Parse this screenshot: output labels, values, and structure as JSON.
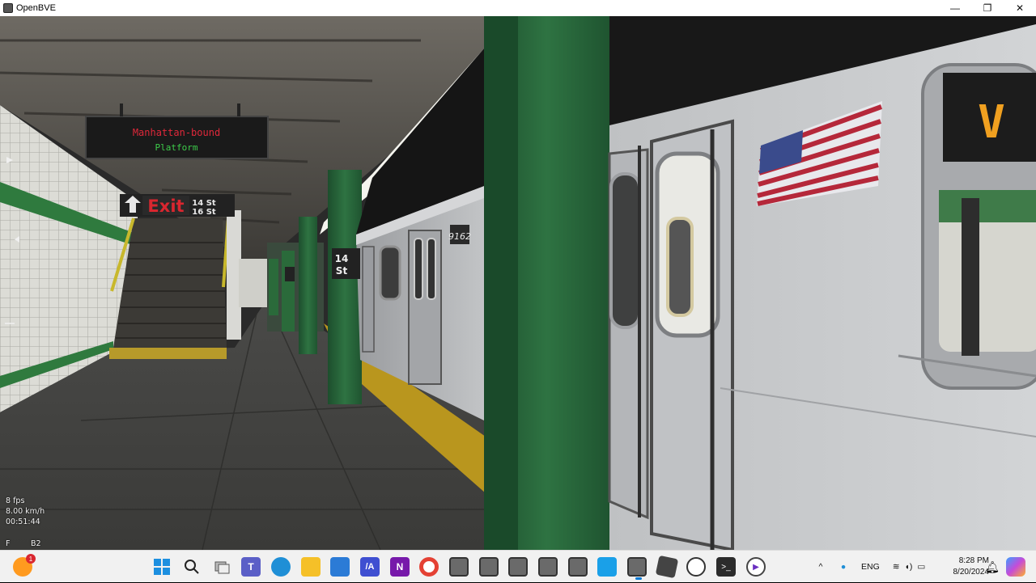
{
  "window": {
    "title": "OpenBVE",
    "minimize": "—",
    "maximize": "❐",
    "close": "✕"
  },
  "scene": {
    "destination_sign_line1": "Manhattan-bound",
    "destination_sign_line2": "Platform",
    "exit_sign": "Exit",
    "exit_streets_1": "14 St",
    "exit_streets_2": "16 St",
    "station_sign_line1": "14",
    "station_sign_line2": "St",
    "car_number": "9162",
    "rollsign_letter": "V"
  },
  "hud": {
    "fps": "8 fps",
    "speed": "8.00 km/h",
    "time": "00:51:44",
    "reverser": "F",
    "power": "B2"
  },
  "taskbar": {
    "language": "ENG",
    "time": "8:28 PM",
    "date": "8/20/2024",
    "notification_badge": "1"
  },
  "colors": {
    "tile_green": "#2f7a3e",
    "column_green": "#24623a",
    "train_silver": "#c9cbcd",
    "taskbar_bg": "#f1f1f1"
  }
}
